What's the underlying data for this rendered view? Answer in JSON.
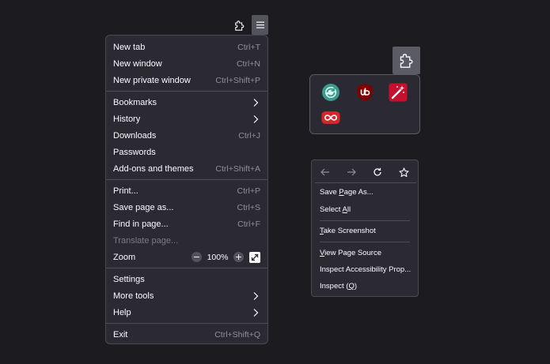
{
  "toolbar": {
    "extensions_icon": "puzzle-icon",
    "menu_icon": "hamburger-icon"
  },
  "app_menu": {
    "items": [
      {
        "label": "New tab",
        "shortcut": "Ctrl+T"
      },
      {
        "label": "New window",
        "shortcut": "Ctrl+N"
      },
      {
        "label": "New private window",
        "shortcut": "Ctrl+Shift+P"
      },
      {
        "label": "Bookmarks",
        "shortcut": ""
      },
      {
        "label": "History",
        "shortcut": ""
      },
      {
        "label": "Downloads",
        "shortcut": "Ctrl+J"
      },
      {
        "label": "Passwords",
        "shortcut": ""
      },
      {
        "label": "Add-ons and themes",
        "shortcut": "Ctrl+Shift+A"
      },
      {
        "label": "Print...",
        "shortcut": "Ctrl+P"
      },
      {
        "label": "Save page as...",
        "shortcut": "Ctrl+S"
      },
      {
        "label": "Find in page...",
        "shortcut": "Ctrl+F"
      },
      {
        "label": "Translate page...",
        "shortcut": ""
      },
      {
        "label": "Zoom",
        "shortcut": ""
      },
      {
        "label": "Settings",
        "shortcut": ""
      },
      {
        "label": "More tools",
        "shortcut": ""
      },
      {
        "label": "Help",
        "shortcut": ""
      },
      {
        "label": "Exit",
        "shortcut": "Ctrl+Shift+Q"
      }
    ],
    "zoom": {
      "minus": "−",
      "value": "100%",
      "plus": "+"
    }
  },
  "extensions_panel": {
    "icons": [
      "sync-extension-icon",
      "ublock-origin-icon",
      "magic-wand-extension-icon",
      "infinity-extension-icon"
    ],
    "colors": {
      "sync": "#3a9c8e",
      "ublock": "#800000",
      "wand": "#c8102e",
      "infinity": "#d7262b"
    }
  },
  "context_menu": {
    "nav_icons": [
      "back-arrow-icon",
      "forward-arrow-icon",
      "reload-icon",
      "bookmark-star-icon"
    ],
    "items": [
      {
        "label": "Save Page As...",
        "access_key": "P"
      },
      {
        "label": "Select All",
        "access_key": "A"
      },
      {
        "label": "Take Screenshot",
        "access_key": "T"
      },
      {
        "label": "View Page Source",
        "access_key": "V"
      },
      {
        "label": "Inspect Accessibility Prop...",
        "access_key": ""
      },
      {
        "label": "Inspect (Q)",
        "access_key": "Q"
      }
    ]
  },
  "theme": {
    "background": "#1c1b1f",
    "menu": "#2b2a33",
    "text": "#fbfbfe",
    "muted": "#8f8f9d"
  }
}
